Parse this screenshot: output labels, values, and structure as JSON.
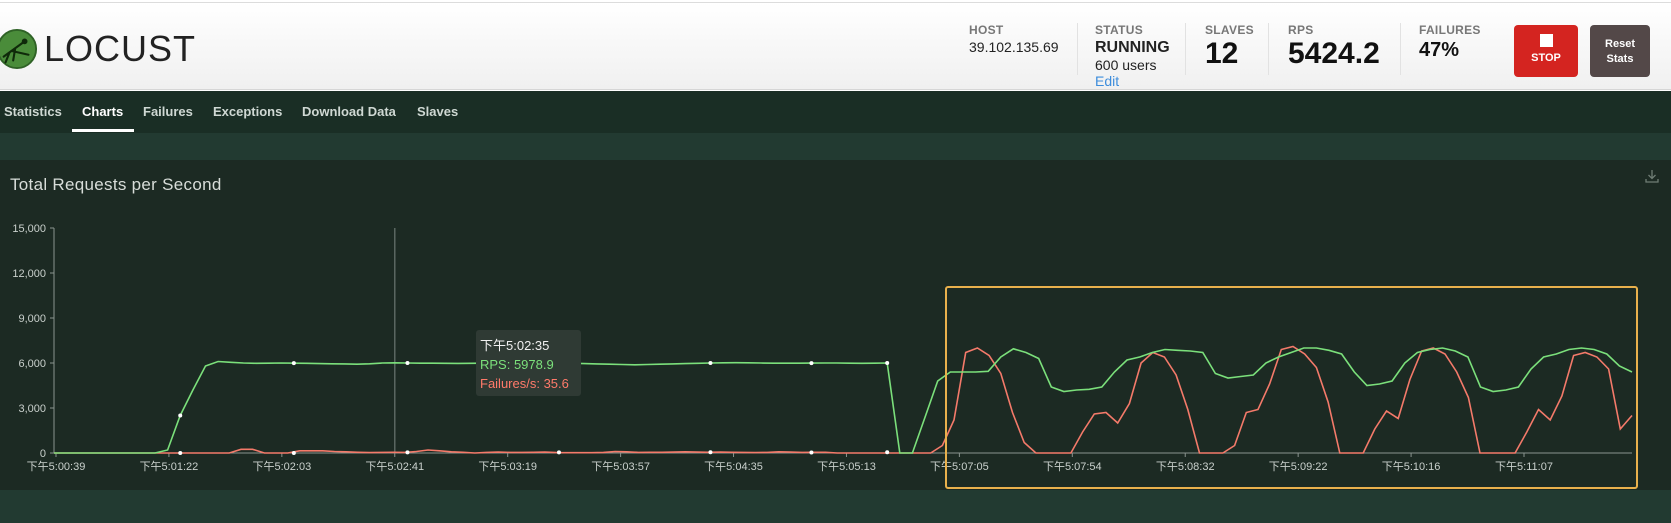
{
  "app": {
    "logo_text": "LOCUST",
    "logo_icon": "locust-logo-icon"
  },
  "header": {
    "host": {
      "label": "HOST",
      "value": "39.102.135.69"
    },
    "status": {
      "label": "STATUS",
      "value": "RUNNING",
      "users": "600 users",
      "edit": "Edit"
    },
    "slaves": {
      "label": "SLAVES",
      "value": "12"
    },
    "rps": {
      "label": "RPS",
      "value": "5424.2"
    },
    "failures": {
      "label": "FAILURES",
      "value": "47%"
    },
    "stop_label": "STOP",
    "reset_label_line1": "Reset",
    "reset_label_line2": "Stats"
  },
  "tabs": [
    {
      "label": "Statistics",
      "active": false
    },
    {
      "label": "Charts",
      "active": true
    },
    {
      "label": "Failures",
      "active": false
    },
    {
      "label": "Exceptions",
      "active": false
    },
    {
      "label": "Download Data",
      "active": false
    },
    {
      "label": "Slaves",
      "active": false
    }
  ],
  "colors": {
    "rps": "#7be07b",
    "failures": "#f47a6a",
    "highlight": "#e8b04c",
    "panel": "#1c2a23"
  },
  "tooltip": {
    "time": "下午5:02:35",
    "rps": "RPS: 5978.9",
    "failures": "Failures/s: 35.6"
  },
  "chart_data": {
    "type": "line",
    "title": "Total Requests per Second",
    "ylim": [
      0,
      15000
    ],
    "yticks": [
      "15,000",
      "12,000",
      "9,000",
      "6,000",
      "3,000",
      "0"
    ],
    "xticks": [
      "下午5:00:39",
      "下午5:01:22",
      "下午5:02:03",
      "下午5:02:41",
      "下午5:03:19",
      "下午5:03:57",
      "下午5:04:35",
      "下午5:05:13",
      "下午5:07:05",
      "下午5:07:54",
      "下午5:08:32",
      "下午5:09:22",
      "下午5:10:16",
      "下午5:11:07"
    ],
    "grid": false,
    "series": [
      {
        "name": "RPS",
        "color": "#7be07b",
        "values": [
          0,
          0,
          0,
          0,
          0,
          0,
          0,
          0,
          0,
          200,
          2500,
          4200,
          5800,
          6100,
          6050,
          6000,
          5980,
          5990,
          6000,
          5990,
          5980,
          5960,
          5950,
          5940,
          5920,
          5950,
          6000,
          6010,
          6000,
          5990,
          5985,
          5980,
          5975,
          5980,
          5990,
          6000,
          5995,
          5980,
          5970,
          5985,
          5990,
          5980,
          5960,
          5940,
          5920,
          5900,
          5880,
          5900,
          5920,
          5940,
          5960,
          5980,
          6000,
          6010,
          6020,
          6010,
          6000,
          5990,
          5985,
          5990,
          5995,
          6000,
          6000,
          5990,
          5980,
          5985,
          6000,
          0,
          0,
          2400,
          4800,
          5400,
          5400,
          5400,
          5450,
          6400,
          6950,
          6700,
          6300,
          4400,
          4100,
          4200,
          4250,
          4400,
          5400,
          6200,
          6400,
          6700,
          6900,
          6850,
          6800,
          6700,
          5300,
          5000,
          5100,
          5200,
          6000,
          6400,
          6700,
          7000,
          7000,
          6850,
          6600,
          5400,
          4500,
          4600,
          4800,
          6000,
          6700,
          6900,
          7000,
          6800,
          6400,
          4400,
          4100,
          4200,
          4400,
          5600,
          6400,
          6600,
          6900,
          7000,
          6900,
          6600,
          5800,
          5400
        ]
      },
      {
        "name": "Failures/s",
        "color": "#f47a6a",
        "values": [
          0,
          0,
          0,
          0,
          0,
          0,
          0,
          0,
          0,
          0,
          0,
          0,
          0,
          0,
          0,
          0,
          250,
          250,
          0,
          0,
          0,
          150,
          150,
          150,
          100,
          80,
          50,
          30,
          40,
          50,
          40,
          100,
          200,
          150,
          80,
          50,
          0,
          40,
          60,
          40,
          40,
          50,
          60,
          30,
          20,
          20,
          20,
          40,
          100,
          80,
          40,
          50,
          50,
          60,
          80,
          60,
          50,
          60,
          50,
          40,
          30,
          40,
          80,
          60,
          40,
          50,
          50,
          0,
          0,
          0,
          0,
          0,
          0,
          0,
          0,
          0,
          500,
          2200,
          6700,
          7000,
          6500,
          5300,
          2700,
          700,
          0,
          0,
          0,
          0,
          1400,
          2600,
          2700,
          2000,
          3300,
          6000,
          6700,
          6400,
          5200,
          2900,
          0,
          0,
          0,
          500,
          2700,
          2900,
          4600,
          6900,
          7100,
          6600,
          5700,
          3400,
          0,
          0,
          0,
          1600,
          2800,
          2300,
          4900,
          6800,
          7000,
          6600,
          5400,
          3700,
          0,
          0,
          0,
          0,
          1400,
          2900,
          2200,
          3800,
          6500,
          6700,
          6400,
          5600,
          1600,
          2500
        ]
      }
    ],
    "tooltip_time": "下午5:02:35",
    "tooltip_rps": 5978.9,
    "tooltip_failures": 35.6
  }
}
